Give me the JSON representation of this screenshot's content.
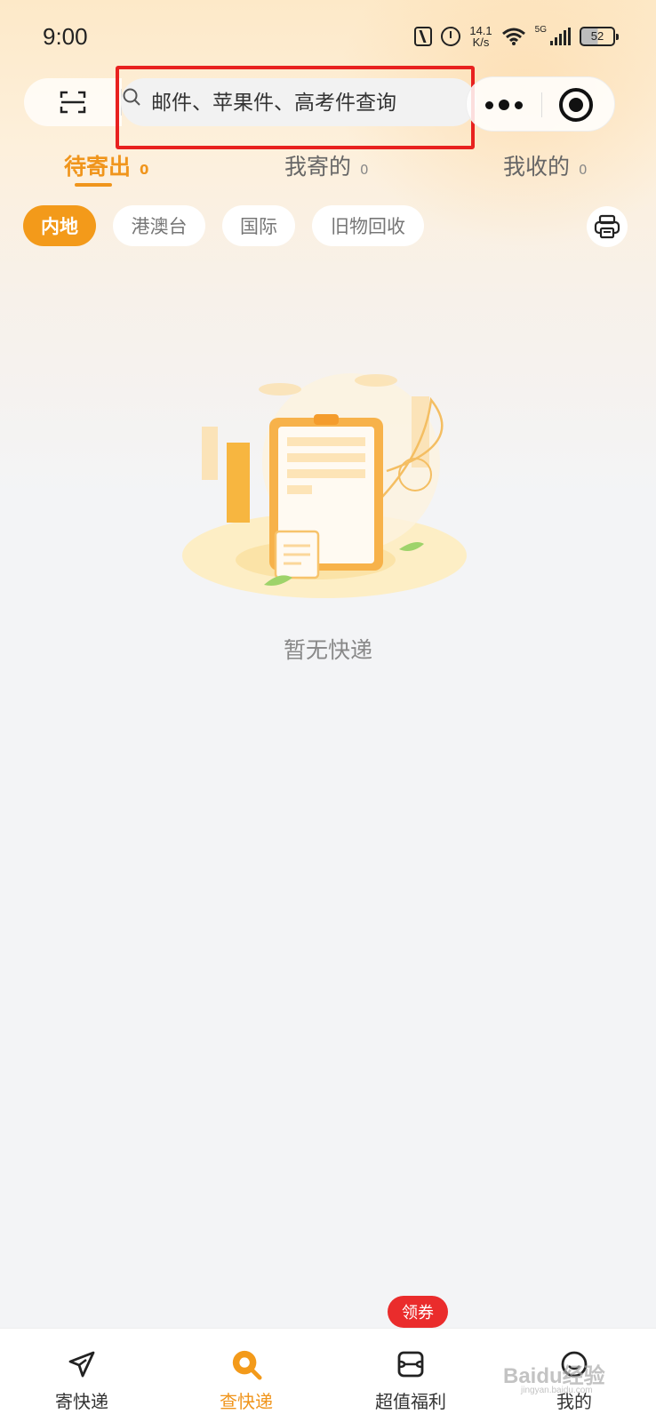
{
  "status_bar": {
    "time": "9:00",
    "speed_value": "14.1",
    "speed_unit": "K/s",
    "network": "5G",
    "battery": "52"
  },
  "header": {
    "search_placeholder": "邮件、苹果件、高考件查询"
  },
  "tabs": [
    {
      "label": "待寄出",
      "count": "0",
      "active": true
    },
    {
      "label": "我寄的",
      "count": "0",
      "active": false
    },
    {
      "label": "我收的",
      "count": "0",
      "active": false
    }
  ],
  "filters": [
    {
      "label": "内地",
      "active": true
    },
    {
      "label": "港澳台",
      "active": false
    },
    {
      "label": "国际",
      "active": false
    },
    {
      "label": "旧物回收",
      "active": false
    }
  ],
  "empty_state": {
    "text": "暂无快递"
  },
  "bottom_nav": {
    "items": [
      {
        "label": "寄快递",
        "icon": "paper-plane-icon",
        "active": false
      },
      {
        "label": "查快递",
        "icon": "search-icon",
        "active": true
      },
      {
        "label": "超值福利",
        "icon": "gift-card-icon",
        "active": false
      },
      {
        "label": "我的",
        "icon": "smiley-icon",
        "active": false
      }
    ],
    "coupon_badge": "领券"
  },
  "watermark": {
    "brand": "Baidu经验",
    "url": "jingyan.baidu.com"
  },
  "colors": {
    "accent": "#f0951c",
    "badge": "#ea2c2c",
    "highlight": "#e8211f"
  }
}
